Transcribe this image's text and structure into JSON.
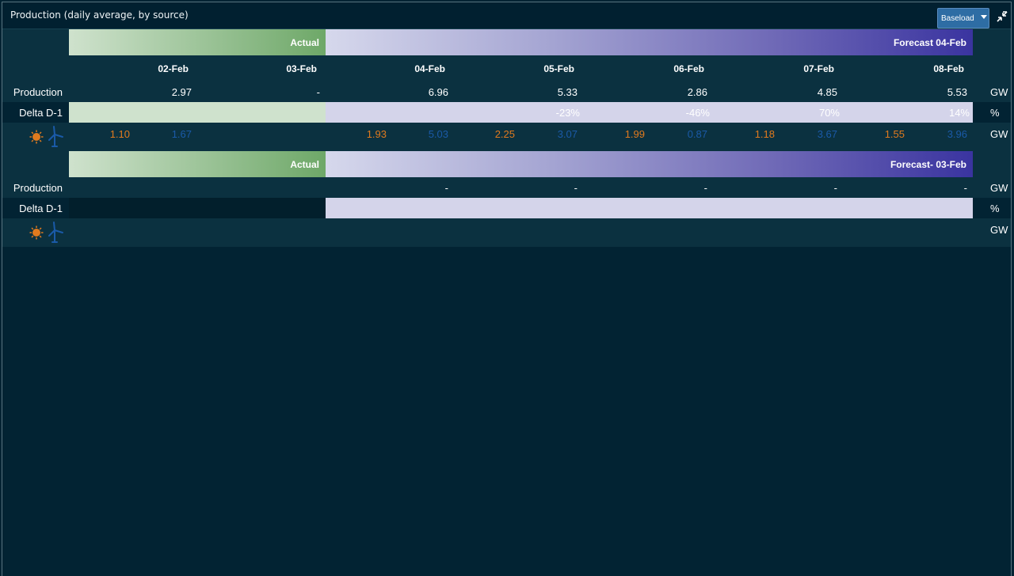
{
  "window": {
    "title": "Production (daily average, by source)",
    "dropdown_label": "Baseload"
  },
  "colors": {
    "solar": "#e07a1e",
    "wind": "#1a5aa8",
    "actual_green": "#6ea868",
    "forecast_purple": "#3a34a0"
  },
  "table1": {
    "actual_label": "Actual",
    "forecast_label": "Forecast 04-Feb",
    "dates": [
      "02-Feb",
      "03-Feb",
      "04-Feb",
      "05-Feb",
      "06-Feb",
      "07-Feb",
      "08-Feb"
    ],
    "production_label": "Production",
    "production_values": [
      "2.97",
      "-",
      "6.96",
      "5.33",
      "2.86",
      "4.85",
      "5.53"
    ],
    "production_unit": "GW",
    "delta_label": "Delta D-1",
    "delta_values": [
      "",
      "",
      "",
      "-23%",
      "-46%",
      "70%",
      "14%"
    ],
    "delta_unit": "%",
    "source_unit": "GW",
    "solar_values": [
      "1.10",
      "",
      "1.93",
      "2.25",
      "1.99",
      "1.18",
      "1.55"
    ],
    "wind_values": [
      "1.67",
      "",
      "5.03",
      "3.07",
      "0.87",
      "3.67",
      "3.96"
    ],
    "icons": [
      "sun-icon",
      "wind-turbine-icon"
    ]
  },
  "table2": {
    "actual_label": "Actual",
    "forecast_label": "Forecast- 03-Feb",
    "production_label": "Production",
    "production_values": [
      "-",
      "-",
      "-",
      "-",
      "-"
    ],
    "production_unit": "GW",
    "delta_label": "Delta D-1",
    "delta_unit": "%",
    "source_unit": "GW",
    "icons": [
      "sun-icon",
      "wind-turbine-icon"
    ]
  }
}
